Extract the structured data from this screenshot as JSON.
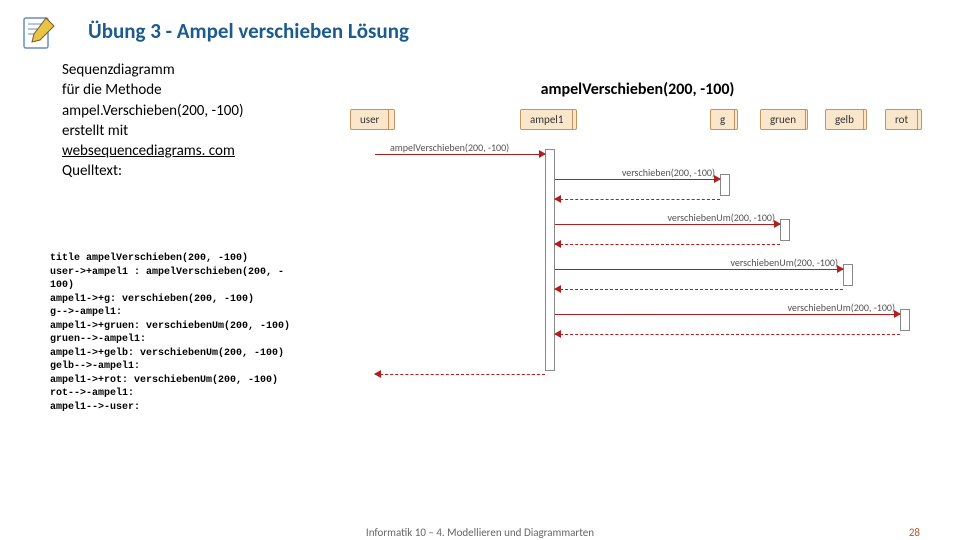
{
  "title": "Übung 3 - Ampel verschieben  Lösung",
  "desc": {
    "l1": "Sequenzdiagramm",
    "l2": "für die Methode",
    "l3": "ampel.Verschieben(200, -100)",
    "l4": "erstellt mit",
    "link": "websequencediagrams. com",
    "l5": "Quelltext:"
  },
  "code": "title ampelVerschieben(200, -100)\nuser->+ampel1 : ampelVerschieben(200, -\n100)\nampel1->+g: verschieben(200, -100)\ng-->-ampel1:\nampel1->+gruen: verschiebenUm(200, -100)\ngruen-->-ampel1:\nampel1->+gelb: verschiebenUm(200, -100)\ngelb-->-ampel1:\nampel1->+rot: verschiebenUm(200, -100)\nrot-->-ampel1:\nampel1-->-user:",
  "diagram": {
    "title": "ampelVerschieben(200, -100)",
    "actors": [
      "user",
      "ampel1",
      "g",
      "gruen",
      "gelb",
      "rot"
    ],
    "messages": [
      "ampelVerschieben(200, -100)",
      "verschieben(200, -100)",
      "verschiebenUm(200, -100)",
      "verschiebenUm(200, -100)",
      "verschiebenUm(200, -100)"
    ]
  },
  "footer": {
    "center": "Informatik 10 – 4. Modellieren und Diagrammarten",
    "page": "28"
  }
}
